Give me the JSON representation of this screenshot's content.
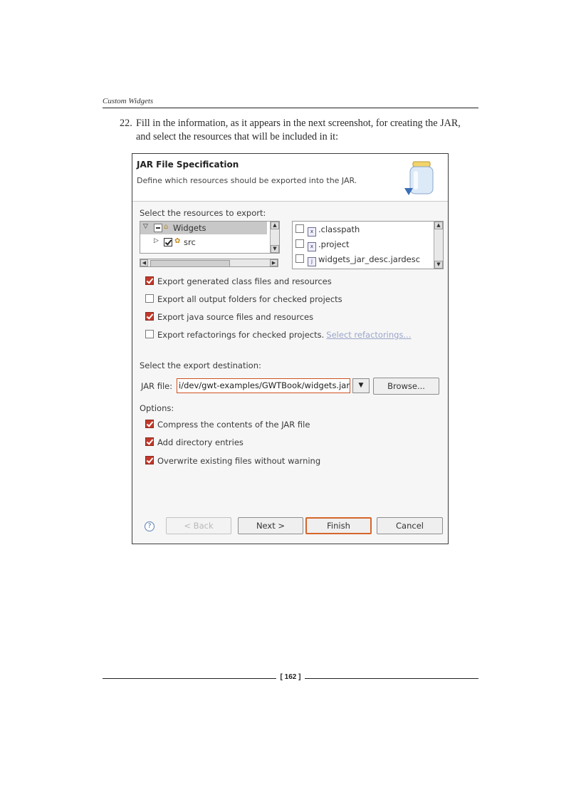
{
  "header": {
    "running_head": "Custom Widgets"
  },
  "step": {
    "number": "22.",
    "text": "Fill in the information, as it appears in the next screenshot, for creating the JAR, and select the resources that will be included in it:"
  },
  "dialog": {
    "title": "JAR File Specification",
    "description": "Define which resources should be exported into the JAR.",
    "resources_label": "Select the resources to export:",
    "tree": [
      {
        "label": "Widgets",
        "check": "partial",
        "expanded": true,
        "selected": true
      },
      {
        "label": "src",
        "check": "checked",
        "expanded": false,
        "selected": false
      }
    ],
    "files": [
      {
        "label": ".classpath",
        "checked": false
      },
      {
        "label": ".project",
        "checked": false
      },
      {
        "label": "widgets_jar_desc.jardesc",
        "checked": false
      }
    ],
    "export_options": [
      {
        "label": "Export generated class files and resources",
        "checked": true
      },
      {
        "label": "Export all output folders for checked projects",
        "checked": false
      },
      {
        "label": "Export java source files and resources",
        "checked": true
      },
      {
        "label": "Export refactorings for checked projects.",
        "checked": false
      }
    ],
    "select_refactorings_link": "Select refactorings...",
    "destination_label": "Select the export destination:",
    "jar_file_label": "JAR file:",
    "jar_file_value": "i/dev/gwt-examples/GWTBook/widgets.jar",
    "browse_label": "Browse...",
    "options_label": "Options:",
    "options": [
      {
        "label": "Compress the contents of the JAR file",
        "checked": true
      },
      {
        "label": "Add directory entries",
        "checked": true
      },
      {
        "label": "Overwrite existing files without warning",
        "checked": true
      }
    ],
    "buttons": {
      "help": "?",
      "back": "< Back",
      "next": "Next >",
      "finish": "Finish",
      "cancel": "Cancel"
    }
  },
  "footer": {
    "page_number": "[ 162 ]"
  }
}
